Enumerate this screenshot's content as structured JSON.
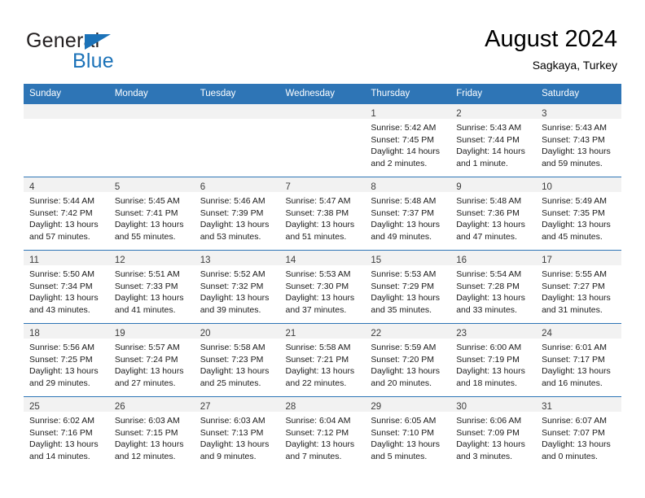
{
  "brand": {
    "name_part1": "General",
    "name_part2": "Blue",
    "accent_color": "#1b72b8",
    "triangle_icon": "brand-triangle-icon"
  },
  "header": {
    "title": "August 2024",
    "subtitle": "Sagkaya, Turkey",
    "header_bg": "#2e75b6",
    "header_text_color": "#ffffff"
  },
  "weekdays": [
    "Sunday",
    "Monday",
    "Tuesday",
    "Wednesday",
    "Thursday",
    "Friday",
    "Saturday"
  ],
  "weeks": [
    [
      {
        "day": "",
        "lines": []
      },
      {
        "day": "",
        "lines": []
      },
      {
        "day": "",
        "lines": []
      },
      {
        "day": "",
        "lines": []
      },
      {
        "day": "1",
        "lines": [
          "Sunrise: 5:42 AM",
          "Sunset: 7:45 PM",
          "Daylight: 14 hours",
          "and 2 minutes."
        ]
      },
      {
        "day": "2",
        "lines": [
          "Sunrise: 5:43 AM",
          "Sunset: 7:44 PM",
          "Daylight: 14 hours",
          "and 1 minute."
        ]
      },
      {
        "day": "3",
        "lines": [
          "Sunrise: 5:43 AM",
          "Sunset: 7:43 PM",
          "Daylight: 13 hours",
          "and 59 minutes."
        ]
      }
    ],
    [
      {
        "day": "4",
        "lines": [
          "Sunrise: 5:44 AM",
          "Sunset: 7:42 PM",
          "Daylight: 13 hours",
          "and 57 minutes."
        ]
      },
      {
        "day": "5",
        "lines": [
          "Sunrise: 5:45 AM",
          "Sunset: 7:41 PM",
          "Daylight: 13 hours",
          "and 55 minutes."
        ]
      },
      {
        "day": "6",
        "lines": [
          "Sunrise: 5:46 AM",
          "Sunset: 7:39 PM",
          "Daylight: 13 hours",
          "and 53 minutes."
        ]
      },
      {
        "day": "7",
        "lines": [
          "Sunrise: 5:47 AM",
          "Sunset: 7:38 PM",
          "Daylight: 13 hours",
          "and 51 minutes."
        ]
      },
      {
        "day": "8",
        "lines": [
          "Sunrise: 5:48 AM",
          "Sunset: 7:37 PM",
          "Daylight: 13 hours",
          "and 49 minutes."
        ]
      },
      {
        "day": "9",
        "lines": [
          "Sunrise: 5:48 AM",
          "Sunset: 7:36 PM",
          "Daylight: 13 hours",
          "and 47 minutes."
        ]
      },
      {
        "day": "10",
        "lines": [
          "Sunrise: 5:49 AM",
          "Sunset: 7:35 PM",
          "Daylight: 13 hours",
          "and 45 minutes."
        ]
      }
    ],
    [
      {
        "day": "11",
        "lines": [
          "Sunrise: 5:50 AM",
          "Sunset: 7:34 PM",
          "Daylight: 13 hours",
          "and 43 minutes."
        ]
      },
      {
        "day": "12",
        "lines": [
          "Sunrise: 5:51 AM",
          "Sunset: 7:33 PM",
          "Daylight: 13 hours",
          "and 41 minutes."
        ]
      },
      {
        "day": "13",
        "lines": [
          "Sunrise: 5:52 AM",
          "Sunset: 7:32 PM",
          "Daylight: 13 hours",
          "and 39 minutes."
        ]
      },
      {
        "day": "14",
        "lines": [
          "Sunrise: 5:53 AM",
          "Sunset: 7:30 PM",
          "Daylight: 13 hours",
          "and 37 minutes."
        ]
      },
      {
        "day": "15",
        "lines": [
          "Sunrise: 5:53 AM",
          "Sunset: 7:29 PM",
          "Daylight: 13 hours",
          "and 35 minutes."
        ]
      },
      {
        "day": "16",
        "lines": [
          "Sunrise: 5:54 AM",
          "Sunset: 7:28 PM",
          "Daylight: 13 hours",
          "and 33 minutes."
        ]
      },
      {
        "day": "17",
        "lines": [
          "Sunrise: 5:55 AM",
          "Sunset: 7:27 PM",
          "Daylight: 13 hours",
          "and 31 minutes."
        ]
      }
    ],
    [
      {
        "day": "18",
        "lines": [
          "Sunrise: 5:56 AM",
          "Sunset: 7:25 PM",
          "Daylight: 13 hours",
          "and 29 minutes."
        ]
      },
      {
        "day": "19",
        "lines": [
          "Sunrise: 5:57 AM",
          "Sunset: 7:24 PM",
          "Daylight: 13 hours",
          "and 27 minutes."
        ]
      },
      {
        "day": "20",
        "lines": [
          "Sunrise: 5:58 AM",
          "Sunset: 7:23 PM",
          "Daylight: 13 hours",
          "and 25 minutes."
        ]
      },
      {
        "day": "21",
        "lines": [
          "Sunrise: 5:58 AM",
          "Sunset: 7:21 PM",
          "Daylight: 13 hours",
          "and 22 minutes."
        ]
      },
      {
        "day": "22",
        "lines": [
          "Sunrise: 5:59 AM",
          "Sunset: 7:20 PM",
          "Daylight: 13 hours",
          "and 20 minutes."
        ]
      },
      {
        "day": "23",
        "lines": [
          "Sunrise: 6:00 AM",
          "Sunset: 7:19 PM",
          "Daylight: 13 hours",
          "and 18 minutes."
        ]
      },
      {
        "day": "24",
        "lines": [
          "Sunrise: 6:01 AM",
          "Sunset: 7:17 PM",
          "Daylight: 13 hours",
          "and 16 minutes."
        ]
      }
    ],
    [
      {
        "day": "25",
        "lines": [
          "Sunrise: 6:02 AM",
          "Sunset: 7:16 PM",
          "Daylight: 13 hours",
          "and 14 minutes."
        ]
      },
      {
        "day": "26",
        "lines": [
          "Sunrise: 6:03 AM",
          "Sunset: 7:15 PM",
          "Daylight: 13 hours",
          "and 12 minutes."
        ]
      },
      {
        "day": "27",
        "lines": [
          "Sunrise: 6:03 AM",
          "Sunset: 7:13 PM",
          "Daylight: 13 hours",
          "and 9 minutes."
        ]
      },
      {
        "day": "28",
        "lines": [
          "Sunrise: 6:04 AM",
          "Sunset: 7:12 PM",
          "Daylight: 13 hours",
          "and 7 minutes."
        ]
      },
      {
        "day": "29",
        "lines": [
          "Sunrise: 6:05 AM",
          "Sunset: 7:10 PM",
          "Daylight: 13 hours",
          "and 5 minutes."
        ]
      },
      {
        "day": "30",
        "lines": [
          "Sunrise: 6:06 AM",
          "Sunset: 7:09 PM",
          "Daylight: 13 hours",
          "and 3 minutes."
        ]
      },
      {
        "day": "31",
        "lines": [
          "Sunrise: 6:07 AM",
          "Sunset: 7:07 PM",
          "Daylight: 13 hours",
          "and 0 minutes."
        ]
      }
    ]
  ]
}
